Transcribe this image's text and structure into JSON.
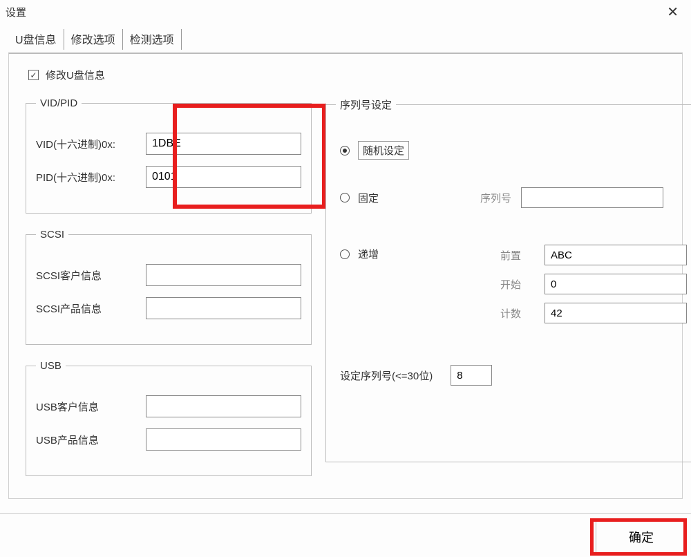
{
  "window": {
    "title": "设置",
    "close_glyph": "✕"
  },
  "tabs": {
    "info": "U盘信息",
    "modify": "修改选项",
    "detect": "检测选项"
  },
  "main": {
    "checkbox_label": "修改U盘信息",
    "checkbox_glyph": "✓"
  },
  "vidpid": {
    "legend": "VID/PID",
    "vid_label": "VID(十六进制)0x:",
    "vid_value": "1DBE",
    "pid_label": "PID(十六进制)0x:",
    "pid_value": "0101"
  },
  "scsi": {
    "legend": "SCSI",
    "customer_label": "SCSI客户信息",
    "customer_value": "",
    "product_label": "SCSI产品信息",
    "product_value": ""
  },
  "usb": {
    "legend": "USB",
    "customer_label": "USB客户信息",
    "customer_value": "",
    "product_label": "USB产品信息",
    "product_value": ""
  },
  "serial": {
    "legend": "序列号设定",
    "random_label": "随机设定",
    "fixed_label": "固定",
    "fixed_serial_label": "序列号",
    "fixed_serial_value": "",
    "incr_label": "递增",
    "prefix_label": "前置",
    "prefix_value": "ABC",
    "start_label": "开始",
    "start_value": "0",
    "count_label": "计数",
    "count_value": "42",
    "setlen_label": "设定序列号(<=30位)",
    "setlen_value": "8"
  },
  "footer": {
    "ok_label": "确定"
  }
}
